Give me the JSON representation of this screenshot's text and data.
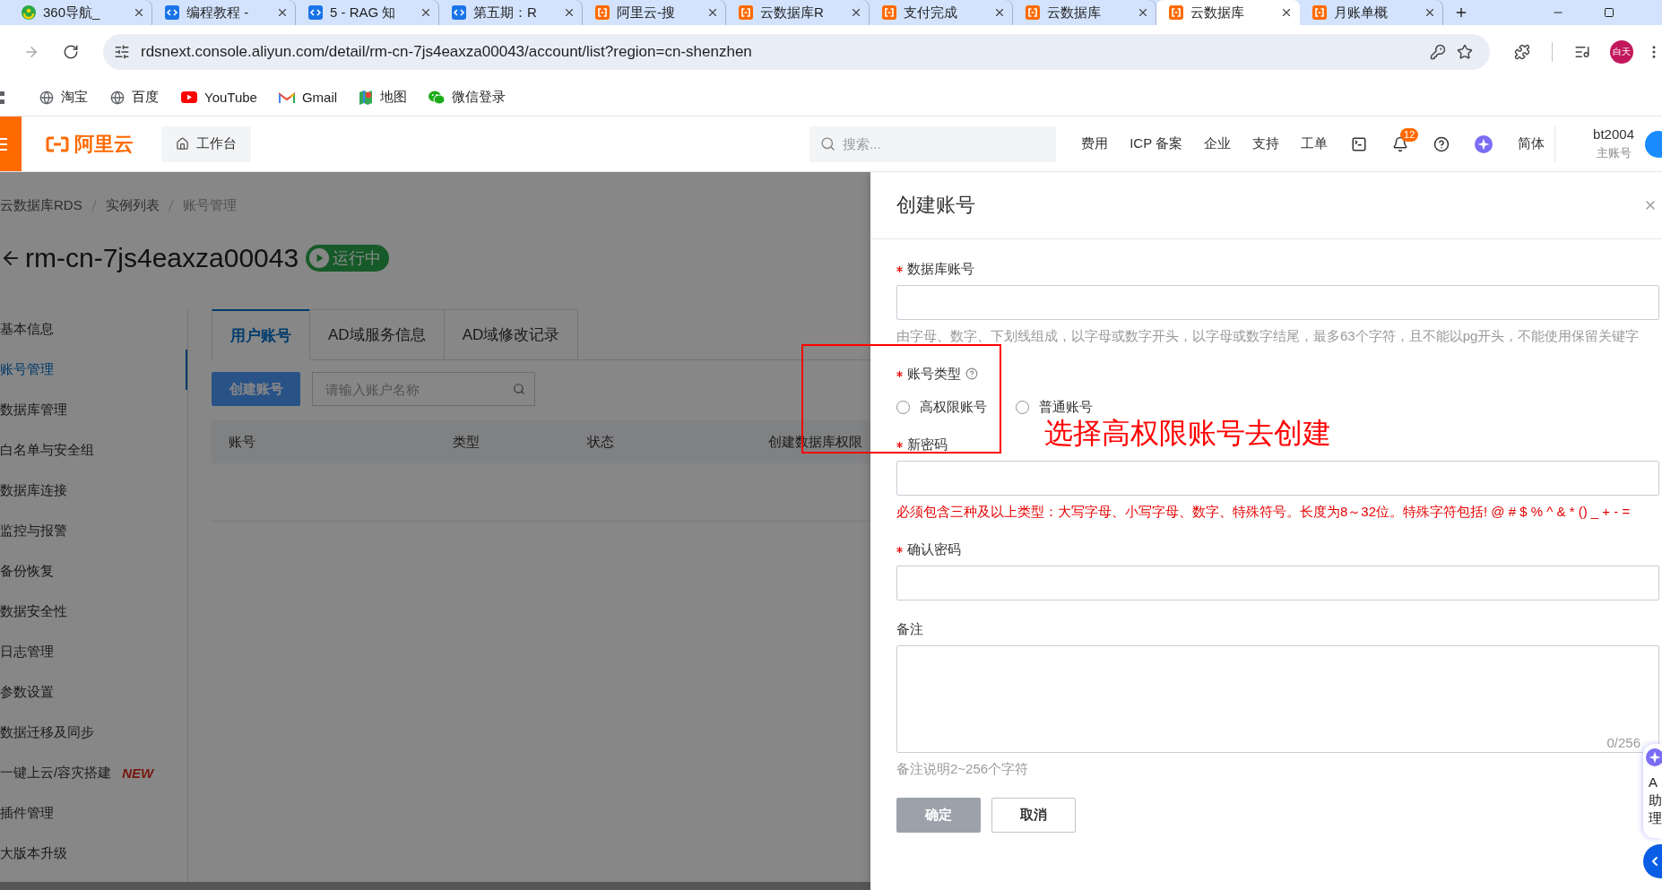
{
  "browser": {
    "tabs": [
      {
        "title": "360导航_",
        "kind": "nav",
        "selected": false
      },
      {
        "title": "编程教程 -",
        "kind": "code",
        "selected": false
      },
      {
        "title": "5 - RAG 知",
        "kind": "code",
        "selected": false
      },
      {
        "title": "第五期：R",
        "kind": "code",
        "selected": false
      },
      {
        "title": "阿里云-搜",
        "kind": "cloud",
        "selected": false
      },
      {
        "title": "云数据库R",
        "kind": "cloud",
        "selected": false
      },
      {
        "title": "支付完成",
        "kind": "cloud",
        "selected": false
      },
      {
        "title": "云数据库",
        "kind": "cloud",
        "selected": false
      },
      {
        "title": "云数据库",
        "kind": "cloud",
        "selected": true
      },
      {
        "title": "月账单概",
        "kind": "cloud",
        "selected": false
      }
    ],
    "url": "rdsnext.console.aliyun.com/detail/rm-cn-7js4eaxza00043/account/list?region=cn-shenzhen",
    "profile": "白天",
    "bookmarks": [
      {
        "label": "淘宝",
        "kind": "globe"
      },
      {
        "label": "百度",
        "kind": "globe"
      },
      {
        "label": "YouTube",
        "kind": "youtube"
      },
      {
        "label": "Gmail",
        "kind": "gmail"
      },
      {
        "label": "地图",
        "kind": "maps"
      },
      {
        "label": "微信登录",
        "kind": "wechat"
      }
    ]
  },
  "header": {
    "logo": "阿里云",
    "workbench": "工作台",
    "search": {
      "placeholder": "搜索..."
    },
    "nav": [
      "费用",
      "ICP 备案",
      "企业",
      "支持",
      "工单"
    ],
    "notification_count": "12",
    "language": "简体",
    "user": {
      "name": "bt2004",
      "role": "主账号"
    }
  },
  "page": {
    "breadcrumb": [
      "云数据库RDS",
      "实例列表",
      "账号管理"
    ],
    "title": "rm-cn-7js4eaxza00043",
    "status": "运行中",
    "sidebar": [
      {
        "label": "基本信息",
        "selected": false
      },
      {
        "label": "账号管理",
        "selected": true
      },
      {
        "label": "数据库管理",
        "selected": false
      },
      {
        "label": "白名单与安全组",
        "selected": false
      },
      {
        "label": "数据库连接",
        "selected": false
      },
      {
        "label": "监控与报警",
        "selected": false
      },
      {
        "label": "备份恢复",
        "selected": false
      },
      {
        "label": "数据安全性",
        "selected": false
      },
      {
        "label": "日志管理",
        "selected": false
      },
      {
        "label": "参数设置",
        "selected": false
      },
      {
        "label": "数据迁移及同步",
        "selected": false
      },
      {
        "label": "一键上云/容灾搭建",
        "selected": false,
        "badge": "NEW"
      },
      {
        "label": "插件管理",
        "selected": false
      },
      {
        "label": "大版本升级",
        "selected": false
      }
    ],
    "tabs": [
      {
        "label": "用户账号",
        "selected": true
      },
      {
        "label": "AD域服务信息",
        "selected": false
      },
      {
        "label": "AD域修改记录",
        "selected": false
      }
    ],
    "create_button": "创建账号",
    "search": {
      "placeholder": "请输入账户名称"
    },
    "table": {
      "columns": [
        "账号",
        "类型",
        "状态",
        "创建数据库权限"
      ]
    }
  },
  "drawer": {
    "title": "创建账号",
    "fields": [
      {
        "kind": "input",
        "label": "数据库账号",
        "required": true,
        "help": false,
        "hint": {
          "text": "由字母、数字、下划线组成，以字母或数字开头，以字母或数字结尾，最多63个字符，且不能以pg开头，不能使用保留关键字",
          "error": false
        }
      },
      {
        "kind": "radio",
        "label": "账号类型",
        "required": true,
        "help": true,
        "options": [
          {
            "label": "高权限账号",
            "selected": false
          },
          {
            "label": "普通账号",
            "selected": false
          }
        ]
      },
      {
        "kind": "input",
        "label": "新密码",
        "required": true,
        "help": false,
        "hint": {
          "text": "必须包含三种及以上类型：大写字母、小写字母、数字、特殊符号。长度为8～32位。特殊字符包括! @ # $ % ^ & * () _ + - =",
          "error": true
        }
      },
      {
        "kind": "input",
        "label": "确认密码",
        "required": true,
        "help": false
      },
      {
        "kind": "textarea",
        "label": "备注",
        "required": false,
        "help": false,
        "counter": "0/256",
        "hint": {
          "text": "备注说明2~256个字符",
          "error": false
        }
      }
    ],
    "buttons": [
      {
        "label": "确定",
        "kind": "primary",
        "disabled": true
      },
      {
        "label": "取消",
        "kind": "secondary",
        "disabled": false
      }
    ]
  },
  "assistant": {
    "lines": [
      "A",
      "助",
      "理"
    ]
  },
  "annotation": {
    "text": "选择高权限账号去创建"
  }
}
